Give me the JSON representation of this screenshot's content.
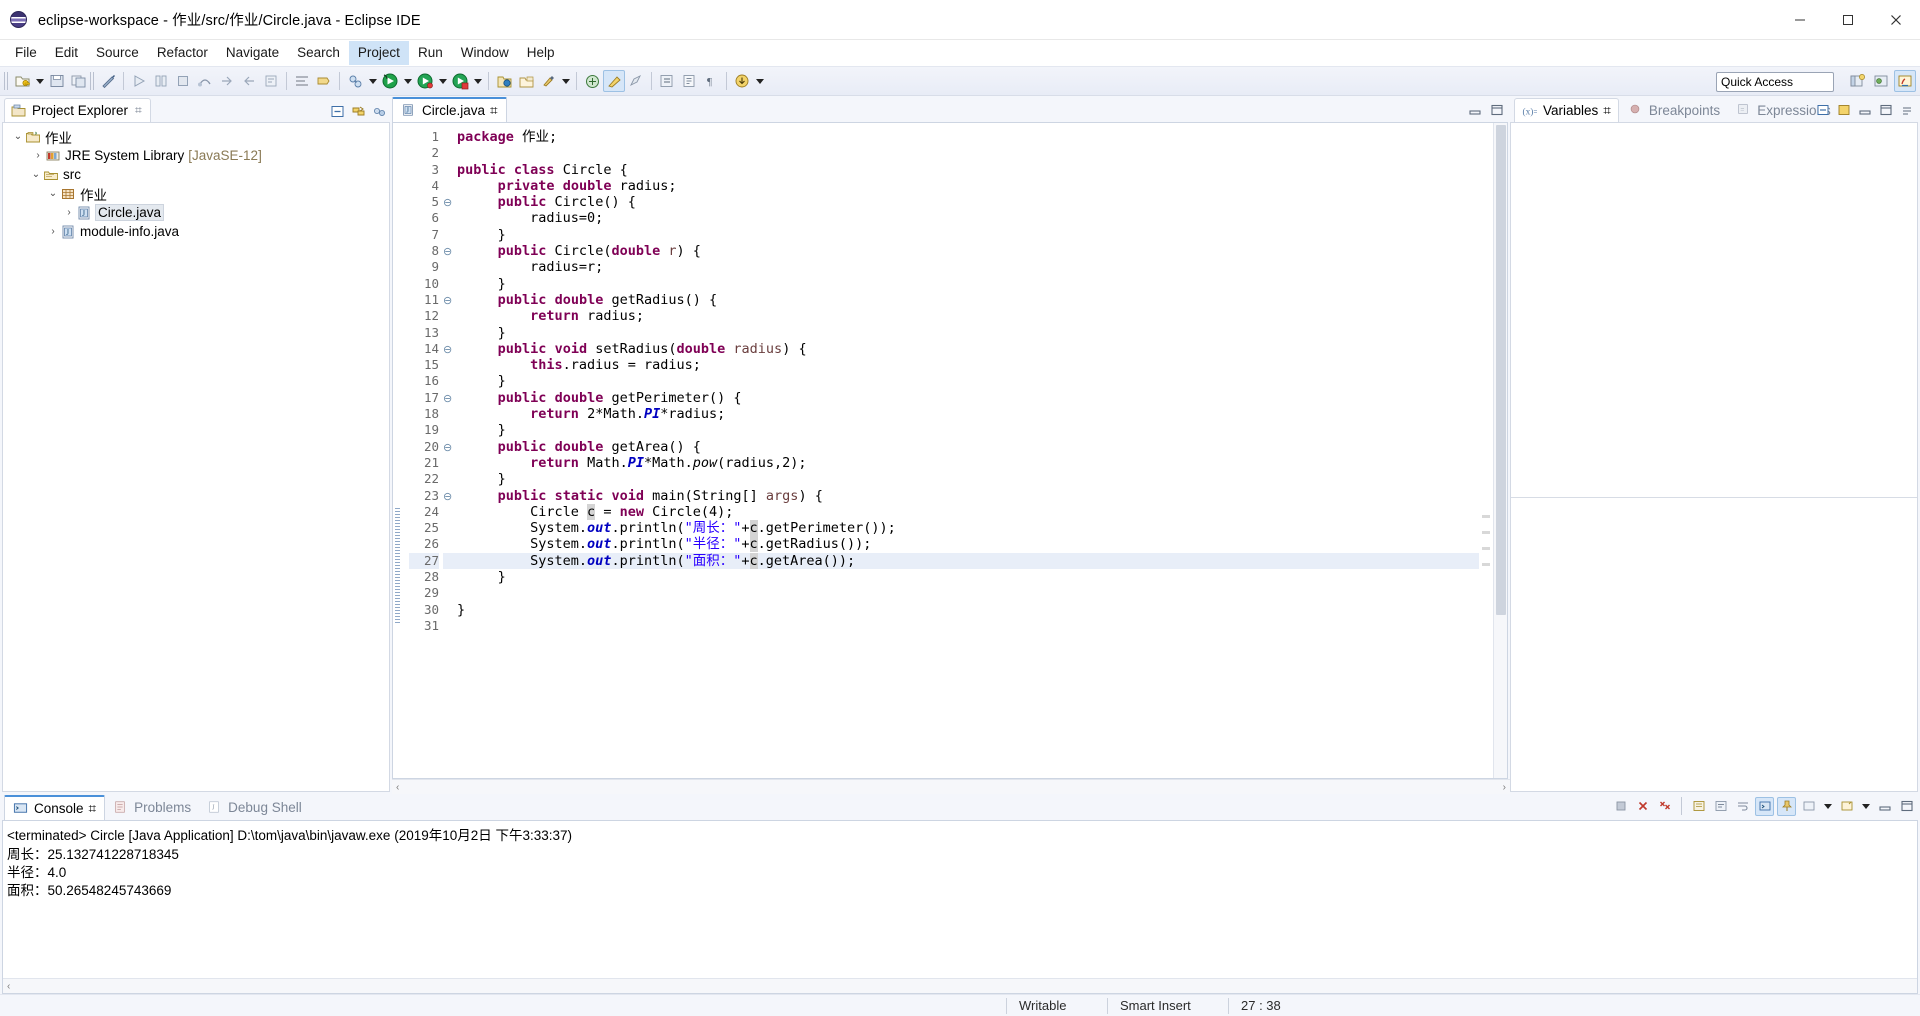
{
  "window": {
    "title": "eclipse-workspace - 作业/src/作业/Circle.java - Eclipse IDE",
    "icon": "eclipse-globe-icon",
    "minimize": "─",
    "maximize": "☐",
    "close": "✕"
  },
  "menubar": {
    "items": [
      {
        "label": "File",
        "active": false
      },
      {
        "label": "Edit",
        "active": false
      },
      {
        "label": "Source",
        "active": false
      },
      {
        "label": "Refactor",
        "active": false
      },
      {
        "label": "Navigate",
        "active": false
      },
      {
        "label": "Search",
        "active": false
      },
      {
        "label": "Project",
        "active": true
      },
      {
        "label": "Run",
        "active": false
      },
      {
        "label": "Window",
        "active": false
      },
      {
        "label": "Help",
        "active": false
      }
    ]
  },
  "toolbar": {
    "quick_access_value": "Quick Access",
    "quick_access_placeholder": "Quick Access"
  },
  "project_explorer": {
    "tab_label": "Project Explorer",
    "close_glyph": "⌗",
    "tree": [
      {
        "indent": 0,
        "twisty": "⌄",
        "icon": "java-project-icon",
        "label": "作业",
        "suffix": "",
        "selected": false
      },
      {
        "indent": 1,
        "twisty": "›",
        "icon": "jre-library-icon",
        "label": "JRE System Library",
        "suffix": "[JavaSE-12]",
        "selected": false
      },
      {
        "indent": 1,
        "twisty": "⌄",
        "icon": "source-folder-icon",
        "label": "src",
        "suffix": "",
        "selected": false
      },
      {
        "indent": 2,
        "twisty": "⌄",
        "icon": "package-icon",
        "label": "作业",
        "suffix": "",
        "selected": false
      },
      {
        "indent": 3,
        "twisty": "›",
        "icon": "java-file-icon",
        "label": "Circle.java",
        "suffix": "",
        "selected": true
      },
      {
        "indent": 2,
        "twisty": "›",
        "icon": "java-file-icon",
        "label": "module-info.java",
        "suffix": "",
        "selected": false
      }
    ]
  },
  "editor": {
    "tab_label": "Circle.java",
    "tab_icon": "java-file-icon",
    "close_glyph": "⌗",
    "current_line": 27,
    "lines": [
      {
        "n": 1,
        "fold": "",
        "html": "<span class=\"kw\">package</span> 作业;"
      },
      {
        "n": 2,
        "fold": "",
        "html": ""
      },
      {
        "n": 3,
        "fold": "",
        "html": "<span class=\"kw\">public</span> <span class=\"kw\">class</span> Circle {"
      },
      {
        "n": 4,
        "fold": "",
        "html": "     <span class=\"kw\">private</span> <span class=\"kw\">double</span> radius;"
      },
      {
        "n": 5,
        "fold": "⊖",
        "html": "     <span class=\"kw\">public</span> Circle() {"
      },
      {
        "n": 6,
        "fold": "",
        "html": "         radius=0;"
      },
      {
        "n": 7,
        "fold": "",
        "html": "     }"
      },
      {
        "n": 8,
        "fold": "⊖",
        "html": "     <span class=\"kw\">public</span> Circle(<span class=\"kw\">double</span> <span class=\"param\">r</span>) {"
      },
      {
        "n": 9,
        "fold": "",
        "html": "         radius=r;"
      },
      {
        "n": 10,
        "fold": "",
        "html": "     }"
      },
      {
        "n": 11,
        "fold": "⊖",
        "html": "     <span class=\"kw\">public</span> <span class=\"kw\">double</span> getRadius() {"
      },
      {
        "n": 12,
        "fold": "",
        "html": "         <span class=\"kw\">return</span> radius;"
      },
      {
        "n": 13,
        "fold": "",
        "html": "     }"
      },
      {
        "n": 14,
        "fold": "⊖",
        "html": "     <span class=\"kw\">public</span> <span class=\"kw\">void</span> setRadius(<span class=\"kw\">double</span> <span class=\"param\">radius</span>) {"
      },
      {
        "n": 15,
        "fold": "",
        "html": "         <span class=\"kw\">this</span>.radius = radius;"
      },
      {
        "n": 16,
        "fold": "",
        "html": "     }"
      },
      {
        "n": 17,
        "fold": "⊖",
        "html": "     <span class=\"kw\">public</span> <span class=\"kw\">double</span> getPerimeter() {"
      },
      {
        "n": 18,
        "fold": "",
        "html": "         <span class=\"kw\">return</span> 2*Math.<span class=\"sfield\">PI</span>*radius;"
      },
      {
        "n": 19,
        "fold": "",
        "html": "     }"
      },
      {
        "n": 20,
        "fold": "⊖",
        "html": "     <span class=\"kw\">public</span> <span class=\"kw\">double</span> getArea() {"
      },
      {
        "n": 21,
        "fold": "",
        "html": "         <span class=\"kw\">return</span> Math.<span class=\"sfield\">PI</span>*Math.<span class=\"meth\">pow</span>(radius,2);"
      },
      {
        "n": 22,
        "fold": "",
        "html": "     }"
      },
      {
        "n": 23,
        "fold": "⊖",
        "html": "     <span class=\"kw\">public</span> <span class=\"kw\">static</span> <span class=\"kw\">void</span> main(String[] <span class=\"param\">args</span>) {"
      },
      {
        "n": 24,
        "fold": "",
        "html": "         Circle <span class=\"hl\">c</span> = <span class=\"kw\">new</span> Circle(4);"
      },
      {
        "n": 25,
        "fold": "",
        "html": "         System.<span class=\"stat\">out</span>.println(<span class=\"str\">\"周长：\"</span>+<span class=\"hl\">c</span>.getPerimeter());"
      },
      {
        "n": 26,
        "fold": "",
        "html": "         System.<span class=\"stat\">out</span>.println(<span class=\"str\">\"半径：\"</span>+<span class=\"hl\">c</span>.getRadius());"
      },
      {
        "n": 27,
        "fold": "",
        "html": "         System.<span class=\"stat\">out</span>.println(<span class=\"str\">\"面积：\"</span>+<span class=\"hl\">c</span>.getArea());"
      },
      {
        "n": 28,
        "fold": "",
        "html": "     }"
      },
      {
        "n": 29,
        "fold": "",
        "html": ""
      },
      {
        "n": 30,
        "fold": "",
        "html": "}"
      },
      {
        "n": 31,
        "fold": "",
        "html": ""
      }
    ]
  },
  "variables_pane": {
    "tabs": [
      {
        "label": "Variables",
        "icon": "variables-icon",
        "active": true,
        "close_glyph": "⌗"
      },
      {
        "label": "Breakpoints",
        "icon": "breakpoints-icon",
        "active": false
      },
      {
        "label": "Expressions",
        "icon": "expressions-icon",
        "active": false
      }
    ]
  },
  "console": {
    "tabs": [
      {
        "label": "Console",
        "icon": "console-icon",
        "active": true,
        "close_glyph": "⌗"
      },
      {
        "label": "Problems",
        "icon": "problems-icon",
        "active": false
      },
      {
        "label": "Debug Shell",
        "icon": "debug-shell-icon",
        "active": false
      }
    ],
    "header": "<terminated> Circle [Java Application] D:\\tom\\java\\bin\\javaw.exe (2019年10月2日 下午3:33:37)",
    "output": [
      "周长：25.132741228718345",
      "半径：4.0",
      "面积：50.26548245743669"
    ]
  },
  "statusbar": {
    "writable": "Writable",
    "insert_mode": "Smart Insert",
    "position": "27 : 38"
  },
  "colors": {
    "accent": "#4a90d9",
    "keyword": "#7f0055",
    "string": "#2a00ff",
    "static_field": "#0000c0",
    "selection": "#e8eef8",
    "menu_active": "#cfe3f7"
  }
}
